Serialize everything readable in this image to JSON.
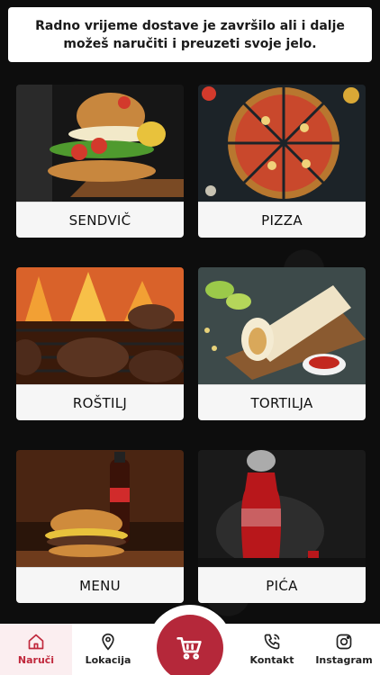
{
  "notice": {
    "line1": "Radno vrijeme dostave je završilo ali i dalje",
    "line2": "možeš naručiti i preuzeti svoje jelo."
  },
  "categories": [
    {
      "label": "SENDVIČ",
      "photo": "sandwich"
    },
    {
      "label": "PIZZA",
      "photo": "pizza"
    },
    {
      "label": "ROŠTILJ",
      "photo": "grill"
    },
    {
      "label": "TORTILJA",
      "photo": "tortilla"
    },
    {
      "label": "MENU",
      "photo": "burger-and-cola"
    },
    {
      "label": "PIĆA",
      "photo": "cola-bottle"
    }
  ],
  "nav": {
    "items": [
      {
        "label": "Naruči",
        "icon": "home-icon",
        "active": true
      },
      {
        "label": "Lokacija",
        "icon": "location-pin-icon",
        "active": false
      },
      {
        "label": "Kontakt",
        "icon": "phone-icon",
        "active": false
      },
      {
        "label": "Instagram",
        "icon": "instagram-icon",
        "active": false
      }
    ],
    "cart_icon": "cart-icon"
  },
  "colors": {
    "accent": "#b5283a",
    "active_nav_bg": "#fbeef0",
    "background": "#0b0b0b"
  }
}
